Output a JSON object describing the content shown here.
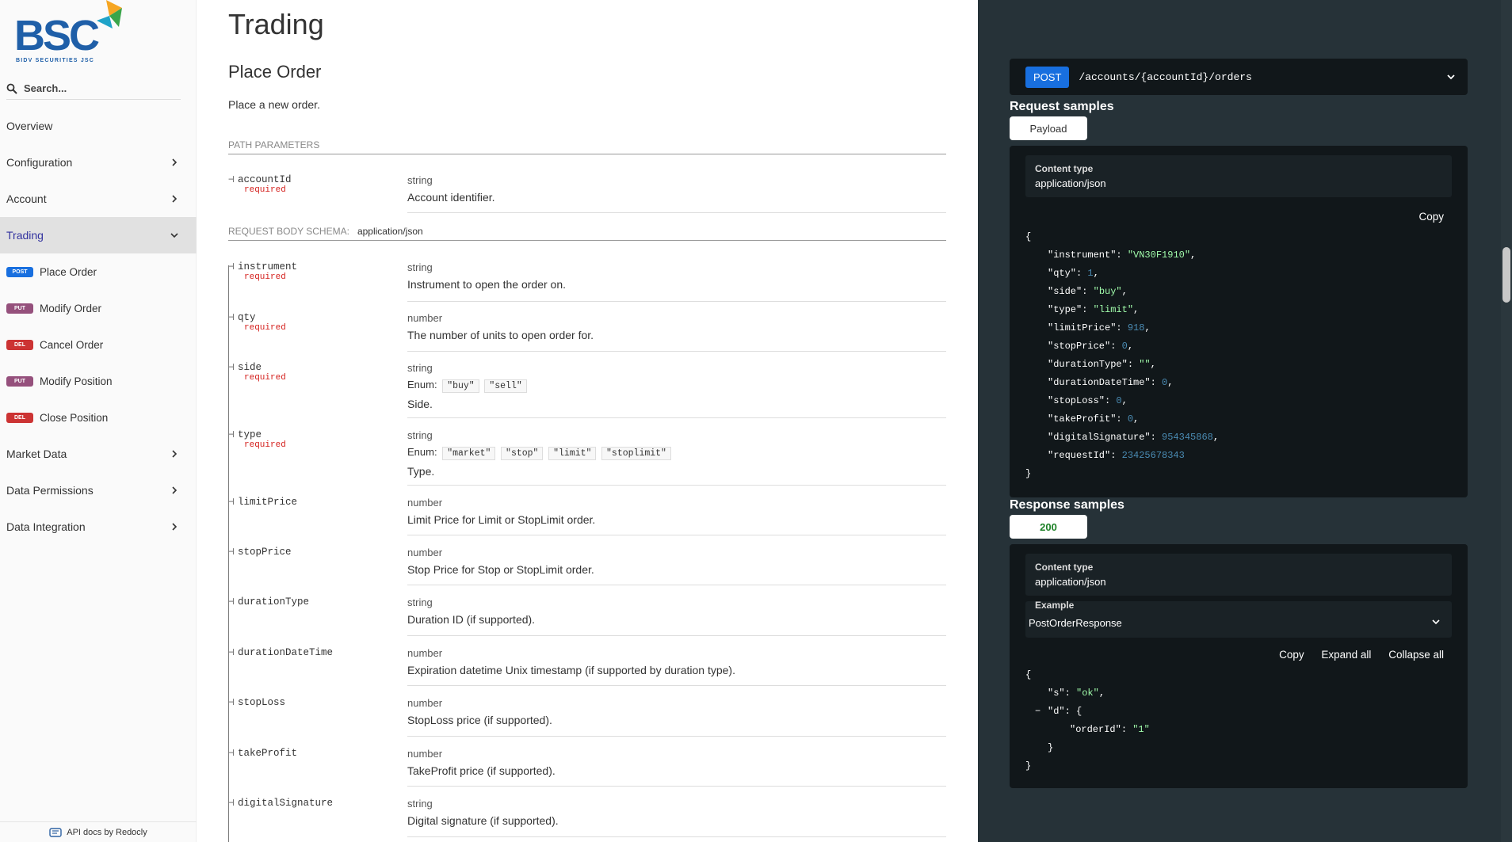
{
  "logo": {
    "text": "BSC",
    "subtitle": "BIDV SECURITIES JSC"
  },
  "search": {
    "placeholder": "Search..."
  },
  "sidebar": {
    "items": [
      {
        "label": "Overview"
      },
      {
        "label": "Configuration"
      },
      {
        "label": "Account"
      },
      {
        "label": "Trading"
      },
      {
        "label": "Market Data"
      },
      {
        "label": "Data Permissions"
      },
      {
        "label": "Data Integration"
      }
    ],
    "trading_sub": [
      {
        "method": "POST",
        "label": "Place Order"
      },
      {
        "method": "PUT",
        "label": "Modify Order"
      },
      {
        "method": "DEL",
        "label": "Cancel Order"
      },
      {
        "method": "PUT",
        "label": "Modify Position"
      },
      {
        "method": "DEL",
        "label": "Close Position"
      }
    ],
    "footer": "API docs by Redocly"
  },
  "main": {
    "section_title": "Trading",
    "op_title": "Place Order",
    "op_desc": "Place a new order.",
    "path_params_label": "PATH PARAMETERS",
    "path_params": [
      {
        "name": "accountId",
        "required": "required",
        "type": "string",
        "desc": "Account identifier."
      }
    ],
    "body_label": "REQUEST BODY SCHEMA:",
    "body_content_type": "application/json",
    "enum_label": "Enum:",
    "body_params": [
      {
        "name": "instrument",
        "required": "required",
        "type": "string",
        "desc": "Instrument to open the order on."
      },
      {
        "name": "qty",
        "required": "required",
        "type": "number",
        "desc": "The number of units to open order for."
      },
      {
        "name": "side",
        "required": "required",
        "type": "string",
        "enum": [
          "\"buy\"",
          "\"sell\""
        ],
        "desc": "Side."
      },
      {
        "name": "type",
        "required": "required",
        "type": "string",
        "enum": [
          "\"market\"",
          "\"stop\"",
          "\"limit\"",
          "\"stoplimit\""
        ],
        "desc": "Type."
      },
      {
        "name": "limitPrice",
        "type": "number",
        "desc": "Limit Price for Limit or StopLimit order."
      },
      {
        "name": "stopPrice",
        "type": "number",
        "desc": "Stop Price for Stop or StopLimit order."
      },
      {
        "name": "durationType",
        "type": "string",
        "desc": "Duration ID (if supported)."
      },
      {
        "name": "durationDateTime",
        "type": "number",
        "desc": "Expiration datetime Unix timestamp (if supported by duration type)."
      },
      {
        "name": "stopLoss",
        "type": "number",
        "desc": "StopLoss price (if supported)."
      },
      {
        "name": "takeProfit",
        "type": "number",
        "desc": "TakeProfit price (if supported)."
      },
      {
        "name": "digitalSignature",
        "type": "string",
        "desc": "Digital signature (if supported)."
      }
    ]
  },
  "right": {
    "method": "POST",
    "path": "/accounts/{accountId}/orders",
    "request_samples": "Request samples",
    "payload_tab": "Payload",
    "content_type_label": "Content type",
    "content_type": "application/json",
    "copy": "Copy",
    "expand_all": "Expand all",
    "collapse_all": "Collapse all",
    "request_json": [
      {
        "k": "\"instrument\"",
        "v": "\"VN30F1910\"",
        "t": "str"
      },
      {
        "k": "\"qty\"",
        "v": "1",
        "t": "num"
      },
      {
        "k": "\"side\"",
        "v": "\"buy\"",
        "t": "str"
      },
      {
        "k": "\"type\"",
        "v": "\"limit\"",
        "t": "str"
      },
      {
        "k": "\"limitPrice\"",
        "v": "918",
        "t": "num"
      },
      {
        "k": "\"stopPrice\"",
        "v": "0",
        "t": "num"
      },
      {
        "k": "\"durationType\"",
        "v": "\"\"",
        "t": "str"
      },
      {
        "k": "\"durationDateTime\"",
        "v": "0",
        "t": "num"
      },
      {
        "k": "\"stopLoss\"",
        "v": "0",
        "t": "num"
      },
      {
        "k": "\"takeProfit\"",
        "v": "0",
        "t": "num"
      },
      {
        "k": "\"digitalSignature\"",
        "v": "954345868",
        "t": "num"
      },
      {
        "k": "\"requestId\"",
        "v": "23425678343",
        "t": "num"
      }
    ],
    "response_samples": "Response samples",
    "status_tab": "200",
    "example_label": "Example",
    "example_value": "PostOrderResponse",
    "response_json": {
      "s_key": "\"s\"",
      "s_val": "\"ok\"",
      "d_key": "\"d\"",
      "orderId_key": "\"orderId\"",
      "orderId_val": "\"1\""
    },
    "colors": {
      "panel": "#263238",
      "code_bg": "#11171a",
      "string": "#a0fbaa",
      "number": "#4a8bb3",
      "post": "#186fdf"
    }
  }
}
